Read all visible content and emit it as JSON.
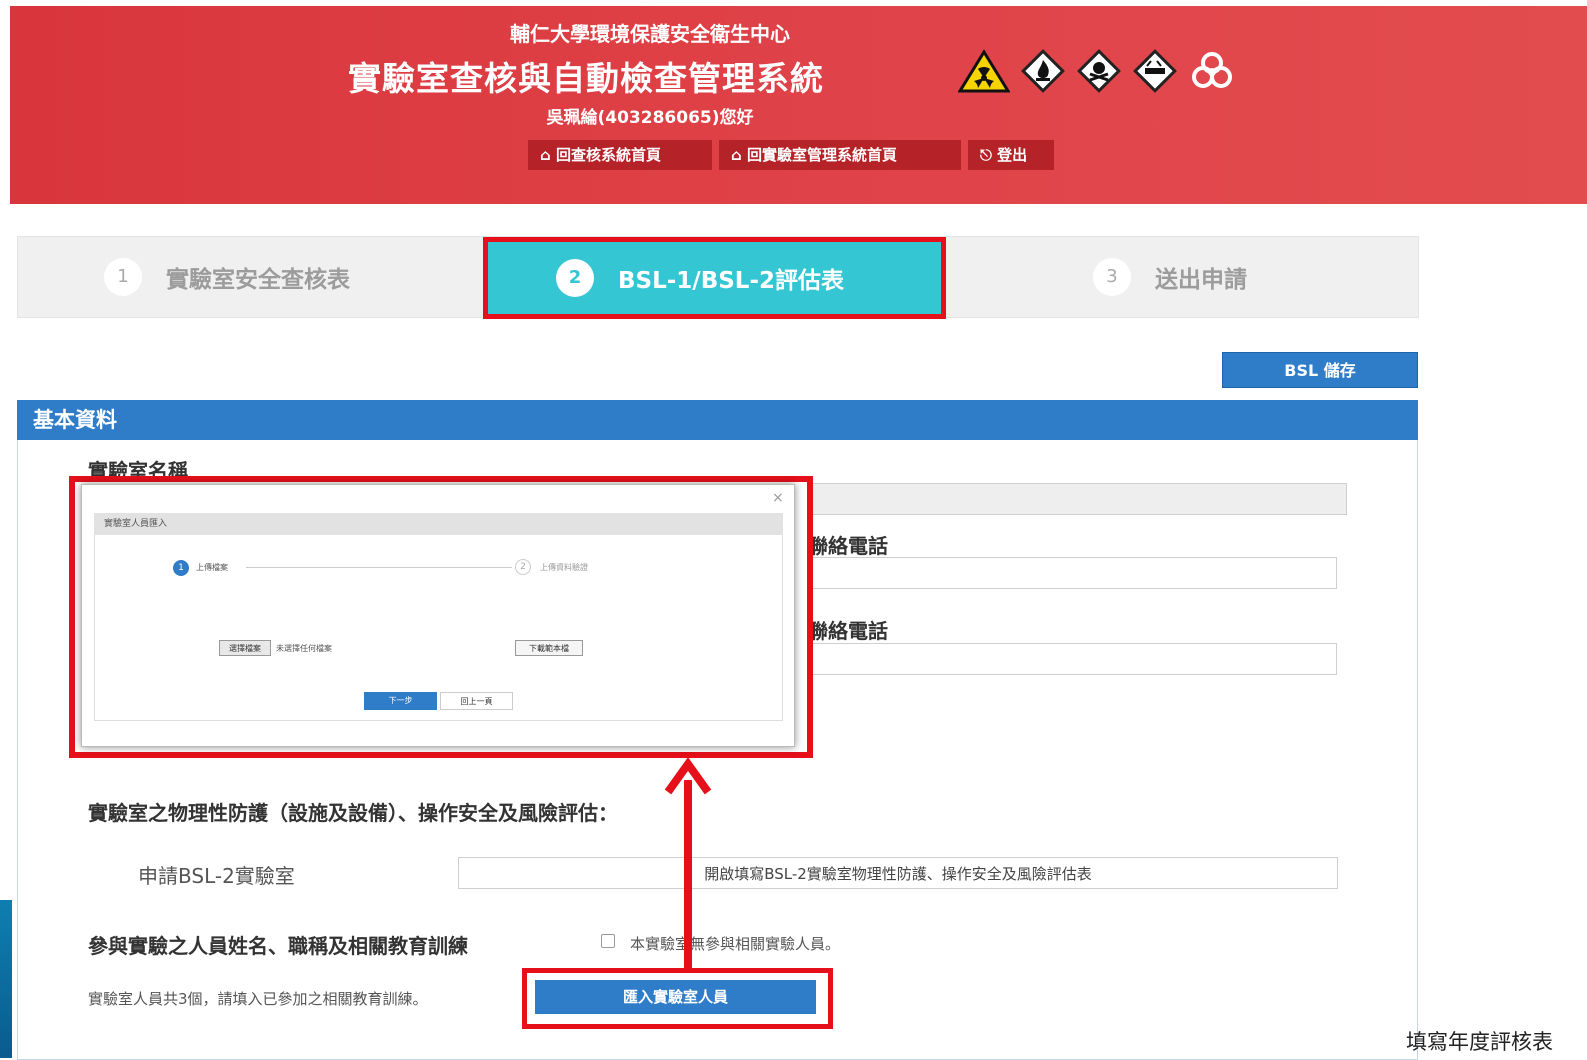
{
  "header": {
    "org_name": "輔仁大學環境保護安全衛生中心",
    "system_title": "實驗室查核與自動檢查管理系統",
    "greeting": "吳珮綸(403286065)您好",
    "nav": [
      {
        "label": "回查核系統首頁",
        "icon": "home-icon"
      },
      {
        "label": "回實驗室管理系統首頁",
        "icon": "home-icon"
      },
      {
        "label": "登出",
        "icon": "logout-icon"
      }
    ],
    "hazard_icons": [
      "radiation-icon",
      "flammable-icon",
      "toxic-icon",
      "corrosive-icon",
      "biohazard-icon"
    ]
  },
  "steps": [
    {
      "num": "1",
      "label": "實驗室安全查核表"
    },
    {
      "num": "2",
      "label": "BSL-1/BSL-2評估表"
    },
    {
      "num": "3",
      "label": "送出申請"
    }
  ],
  "toolbar": {
    "save_label": "BSL 儲存"
  },
  "panel": {
    "title": "基本資料",
    "lab_name_label": "實驗室名稱",
    "phone1_label": "聯絡電話",
    "phone2_label": "聯絡電話",
    "physical_label": "實驗室之物理性防護（設施及設備）、操作安全及風險評估：",
    "bsl2_label": "申請BSL-2實驗室",
    "bsl2_button": "開啟填寫BSL-2實驗室物理性防護、操作安全及風險評估表",
    "people_label": "參與實驗之人員姓名、職稱及相關教育訓練",
    "no_people_checkbox": "本實驗室無參與相關實驗人員。",
    "people_count_text": "實驗室人員共3個，請填入已參加之相關教育訓練。",
    "import_button": "匯入實驗室人員"
  },
  "modal": {
    "title": "實驗室人員匯入",
    "close": "×",
    "step1_num": "1",
    "step1_label": "上傳檔案",
    "step2_num": "2",
    "step2_label": "上傳資料驗證",
    "choose_file": "選擇檔案",
    "no_file": "未選擇任何檔案",
    "download_sample": "下載範本檔",
    "next": "下一步",
    "back": "回上一頁"
  },
  "caption": "填寫年度評核表"
}
